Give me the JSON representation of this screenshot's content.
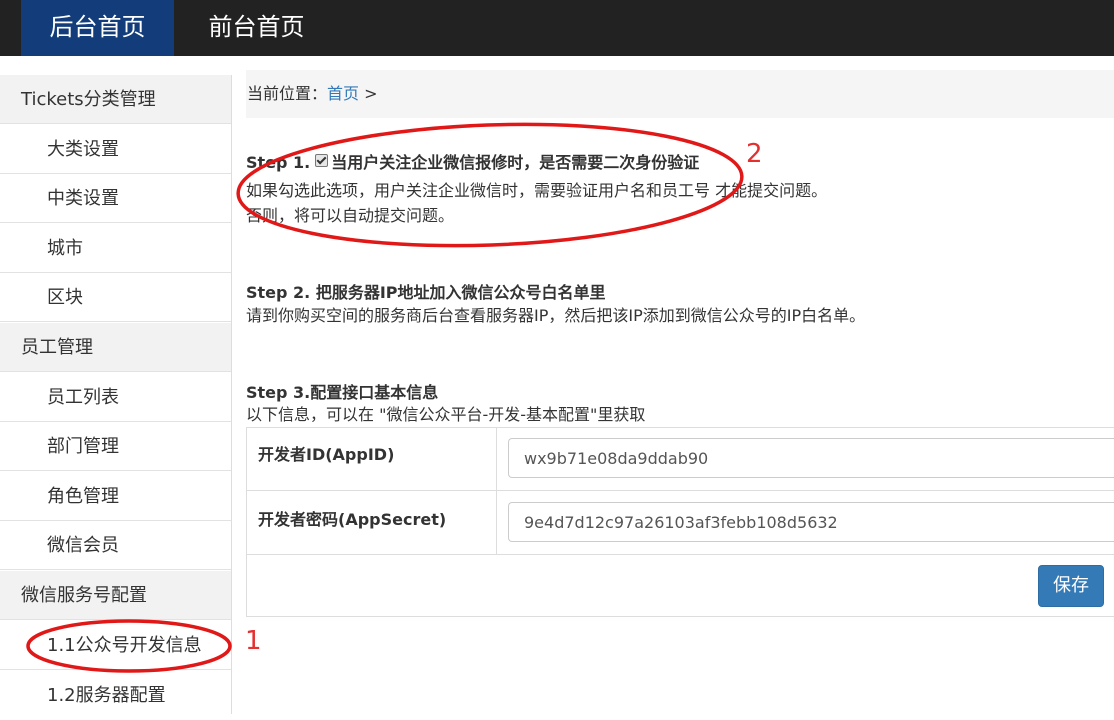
{
  "topnav": {
    "items": [
      {
        "label": "后台首页",
        "active": true
      },
      {
        "label": "前台首页",
        "active": false
      }
    ]
  },
  "sidebar": {
    "rows": [
      {
        "label": "Tickets分类管理",
        "type": "category"
      },
      {
        "label": "大类设置",
        "type": "item"
      },
      {
        "label": "中类设置",
        "type": "item"
      },
      {
        "label": "城市",
        "type": "item"
      },
      {
        "label": "区块",
        "type": "item"
      },
      {
        "label": "员工管理",
        "type": "category"
      },
      {
        "label": "员工列表",
        "type": "item"
      },
      {
        "label": "部门管理",
        "type": "item"
      },
      {
        "label": "角色管理",
        "type": "item"
      },
      {
        "label": "微信会员",
        "type": "item"
      },
      {
        "label": "微信服务号配置",
        "type": "category"
      },
      {
        "label": "1.1公众号开发信息",
        "type": "item"
      },
      {
        "label": "1.2服务器配置",
        "type": "item"
      }
    ]
  },
  "breadcrumb": {
    "prefix": "当前位置：",
    "home": "首页",
    "separator": " >"
  },
  "step1": {
    "title_prefix": "Step 1.",
    "title": "当用户关注企业微信报修时，是否需要二次身份验证",
    "checked": true,
    "desc_line1": "如果勾选此选项，用户关注企业微信时，需要验证用户名和员工号 才能提交问题。",
    "desc_line2": "否则，将可以自动提交问题。"
  },
  "step2": {
    "title": "Step 2. 把服务器IP地址加入微信公众号白名单里",
    "desc": "请到你购买空间的服务商后台查看服务器IP，然后把该IP添加到微信公众号的IP白名单。"
  },
  "step3": {
    "title": "Step 3.配置接口基本信息",
    "desc": "以下信息，可以在 \"微信公众平台-开发-基本配置\"里获取"
  },
  "form": {
    "appid_label": "开发者ID(AppID)",
    "appid_value": "wx9b71e08da9ddab90",
    "secret_label": "开发者密码(AppSecret)",
    "secret_value": "9e4d7d12c97a26103af3febb108d5632",
    "save_label": "保存"
  },
  "annotations": {
    "mark1": "1",
    "mark2": "2",
    "color": "#e01818"
  },
  "colors": {
    "topbar": "#222222",
    "active_nav": "#123d7a",
    "link": "#337ab7",
    "button": "#337ab7"
  }
}
